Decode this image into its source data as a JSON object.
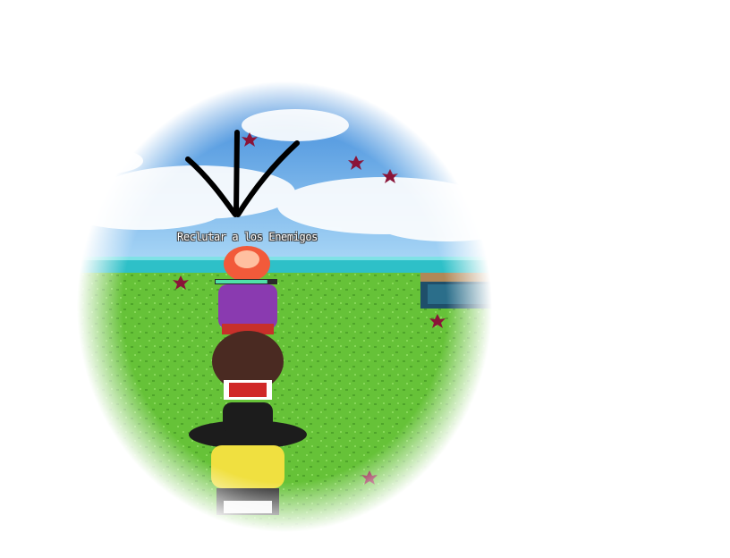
{
  "scene": {
    "npc_label": "Reclutar a los Enemigos",
    "npc_hp_fraction": 0.85,
    "colors": {
      "sky_top": "#3f8fe0",
      "sky_bottom": "#9fd0f5",
      "cloud": "#ffffff",
      "sea": "#27c2c9",
      "grass": "#68c43a",
      "grass_dark": "#4fa52a",
      "leaf": "#8a1438",
      "arrow": "#000000",
      "hp_bar": "#4fe0a8"
    },
    "icons": {
      "arrow": "arrow-down-icon",
      "leaf": "maple-leaf-icon"
    }
  }
}
